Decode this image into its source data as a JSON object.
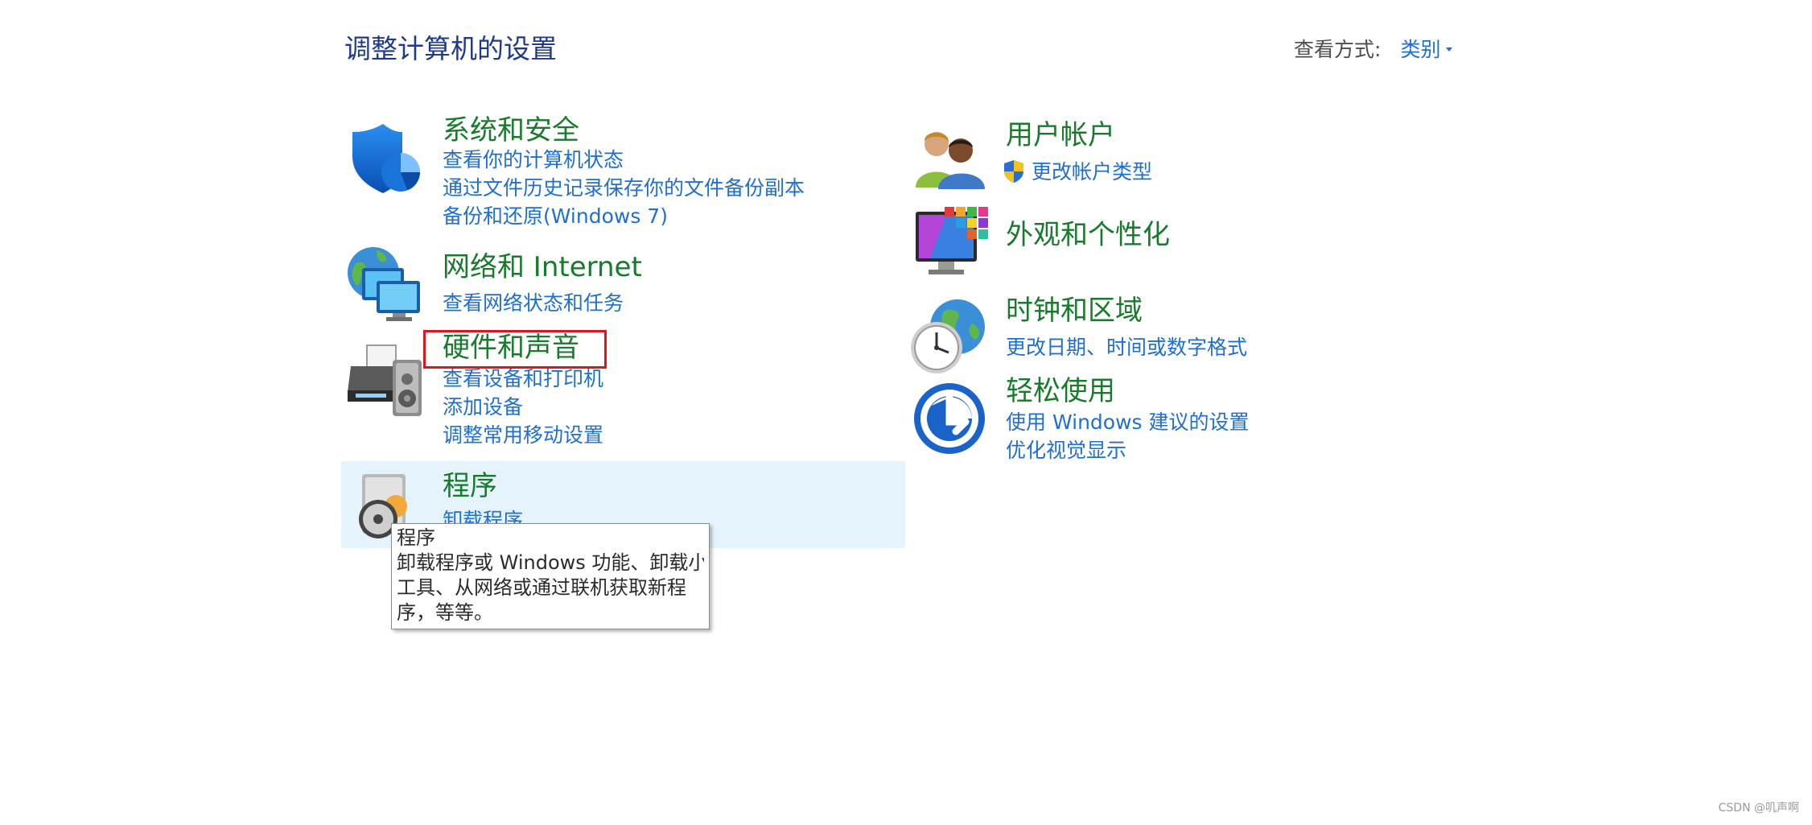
{
  "page_title": "调整计算机的设置",
  "view_by": {
    "label": "查看方式:",
    "value": "类别"
  },
  "left_column": [
    {
      "title": "系统和安全",
      "icon": "shield-icon",
      "links": [
        "查看你的计算机状态",
        "通过文件历史记录保存你的文件备份副本",
        "备份和还原(Windows 7)"
      ]
    },
    {
      "title": "网络和 Internet",
      "icon": "network-globe-icon",
      "links": [
        "查看网络状态和任务"
      ]
    },
    {
      "title": "硬件和声音",
      "icon": "printer-speaker-icon",
      "links": [
        "查看设备和打印机",
        "添加设备",
        "调整常用移动设置"
      ]
    },
    {
      "title": "程序",
      "icon": "programs-disc-icon",
      "links": [
        "卸载程序"
      ]
    }
  ],
  "right_column": [
    {
      "title": "用户帐户",
      "icon": "users-icon",
      "links": [
        "更改帐户类型"
      ],
      "link_icon": "uac-shield-icon"
    },
    {
      "title": "外观和个性化",
      "icon": "monitor-personalization-icon",
      "links": []
    },
    {
      "title": "时钟和区域",
      "icon": "clock-globe-icon",
      "links": [
        "更改日期、时间或数字格式"
      ]
    },
    {
      "title": "轻松使用",
      "icon": "ease-of-access-icon",
      "links": [
        "使用 Windows 建议的设置",
        "优化视觉显示"
      ]
    }
  ],
  "tooltip": {
    "title": "程序",
    "lines": [
      "卸载程序或 Windows 功能、卸载小",
      "工具、从网络或通过联机获取新程",
      "序，等等。"
    ]
  },
  "watermark": "CSDN @叽声啊",
  "colors": {
    "title_blue": "#1e3a8a",
    "category_green": "#187a2b",
    "link_blue": "#1f6fd1",
    "hover_bg": "#e5f3fd",
    "highlight_red": "#e0141a"
  }
}
